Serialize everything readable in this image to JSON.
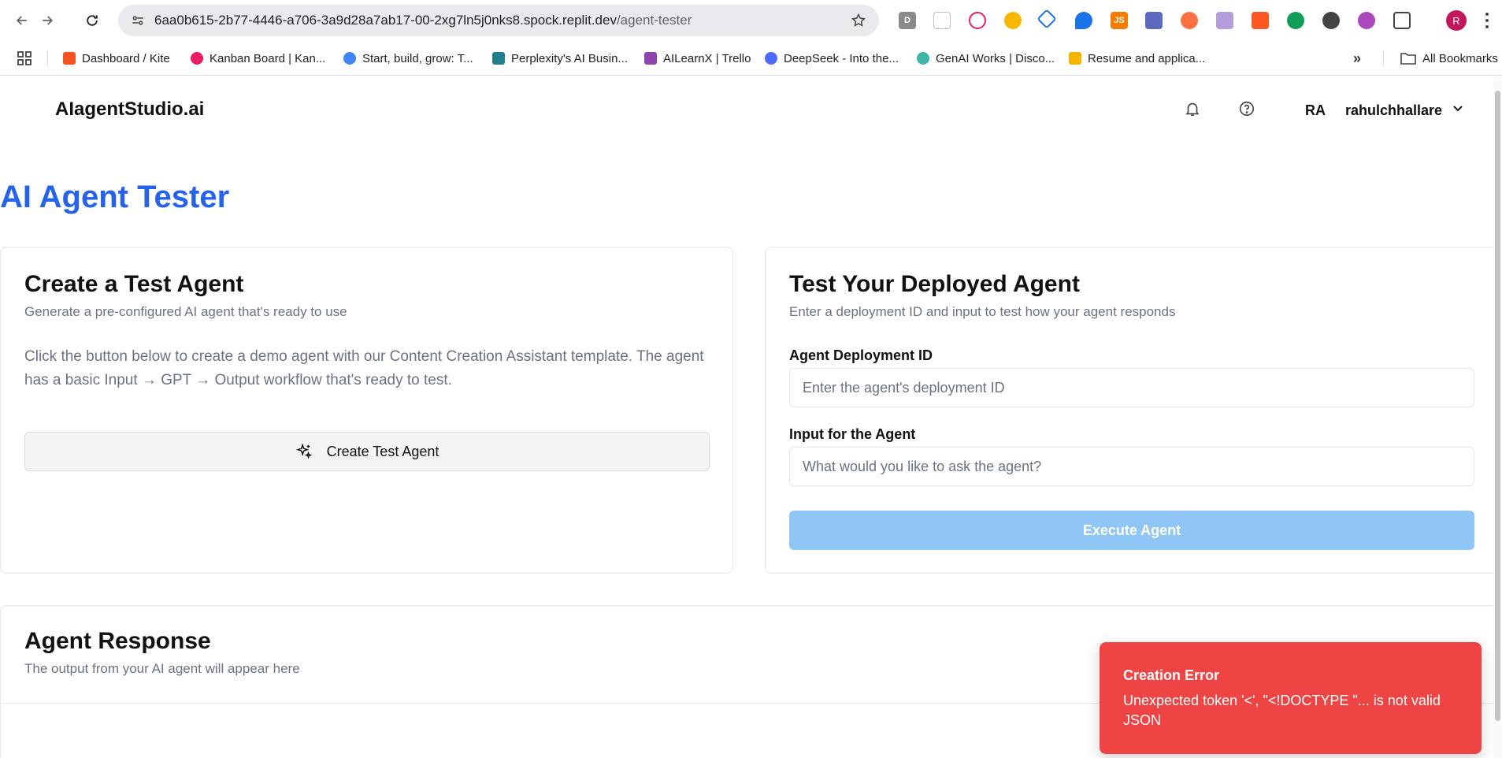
{
  "browser": {
    "url_host": "6aa0b615-2b77-4446-a706-3a9d28a7ab17-00-2xg7ln5j0nks8.spock.replit.dev",
    "url_path": "/agent-tester",
    "profile_initial": "R",
    "extensions": [
      "D",
      "JS"
    ],
    "bookmarks": [
      {
        "label": "Dashboard / Kite",
        "color": "#f4511e"
      },
      {
        "label": "Kanban Board | Kan...",
        "color": "#e91e63"
      },
      {
        "label": "Start, build, grow: T...",
        "color": "#4285f4"
      },
      {
        "label": "Perplexity's AI Busin...",
        "color": "#20808d"
      },
      {
        "label": "AILearnX | Trello",
        "color": "#8e44ad"
      },
      {
        "label": "DeepSeek - Into the...",
        "color": "#4d6bfe"
      },
      {
        "label": "GenAI Works | Disco...",
        "color": "#3fb6a8"
      },
      {
        "label": "Resume and applica...",
        "color": "#f4b400"
      }
    ],
    "all_bookmarks_label": "All Bookmarks"
  },
  "header": {
    "brand": "AIagentStudio.ai",
    "user_initials": "RA",
    "user_name": "rahulchhallare"
  },
  "page_title": "AI Agent Tester",
  "create_card": {
    "title": "Create a Test Agent",
    "subtitle": "Generate a pre-configured AI agent that's ready to use",
    "body": "Click the button below to create a demo agent with our Content Creation Assistant template. The agent has a basic Input → GPT → Output workflow that's ready to test.",
    "button_label": "Create Test Agent"
  },
  "test_card": {
    "title": "Test Your Deployed Agent",
    "subtitle": "Enter a deployment ID and input to test how your agent responds",
    "deployment_label": "Agent Deployment ID",
    "deployment_placeholder": "Enter the agent's deployment ID",
    "input_label": "Input for the Agent",
    "input_placeholder": "What would you like to ask the agent?",
    "execute_label": "Execute Agent"
  },
  "response_card": {
    "title": "Agent Response",
    "subtitle": "The output from your AI agent will appear here"
  },
  "toast": {
    "title": "Creation Error",
    "message": "Unexpected token '<', \"<!DOCTYPE \"... is not valid JSON"
  },
  "colors": {
    "accent": "#2563eb",
    "execute_disabled": "#8fc6f6",
    "error": "#ef4444"
  }
}
